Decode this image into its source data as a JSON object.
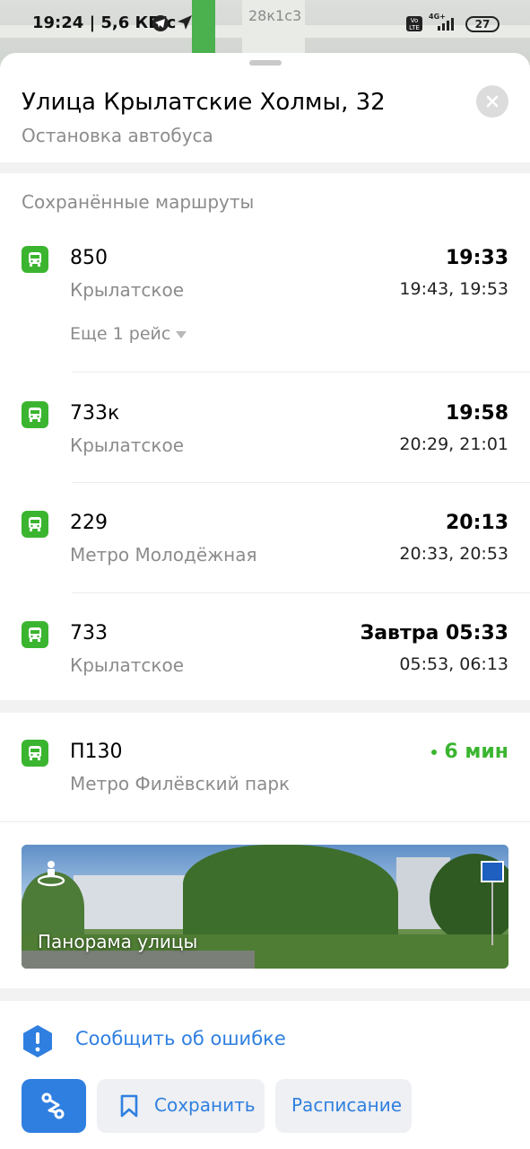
{
  "status_bar": {
    "time": "19:24 | 5,6 КБ/с",
    "network": "4G+",
    "volte": "Vo LTE",
    "battery": "27"
  },
  "map": {
    "label": "28к1с3"
  },
  "header": {
    "title": "Улица Крылатские Холмы, 32",
    "subtitle": "Остановка автобуса"
  },
  "saved_routes": {
    "label": "Сохранённые маршруты",
    "routes": [
      {
        "number": "850",
        "destination": "Крылатское",
        "time": "19:33",
        "next": "19:43, 19:53",
        "more": "Еще 1 рейс"
      },
      {
        "number": "733к",
        "destination": "Крылатское",
        "time": "19:58",
        "next": "20:29, 21:01"
      },
      {
        "number": "229",
        "destination": "Метро Молодёжная",
        "time": "20:13",
        "next": "20:33, 20:53"
      },
      {
        "number": "733",
        "destination": "Крылатское",
        "time": "Завтра 05:33",
        "next": "05:53, 06:13"
      }
    ]
  },
  "live_route": {
    "number": "П130",
    "destination": "Метро Филёвский парк",
    "eta": "6 мин"
  },
  "panorama": {
    "label": "Панорама улицы"
  },
  "report": {
    "label": "Сообщить об ошибке"
  },
  "actions": {
    "save": "Сохранить",
    "schedule": "Расписание"
  },
  "colors": {
    "accent": "#2f7fe0",
    "bus_green": "#3bb530",
    "muted": "#8c8c8c"
  }
}
